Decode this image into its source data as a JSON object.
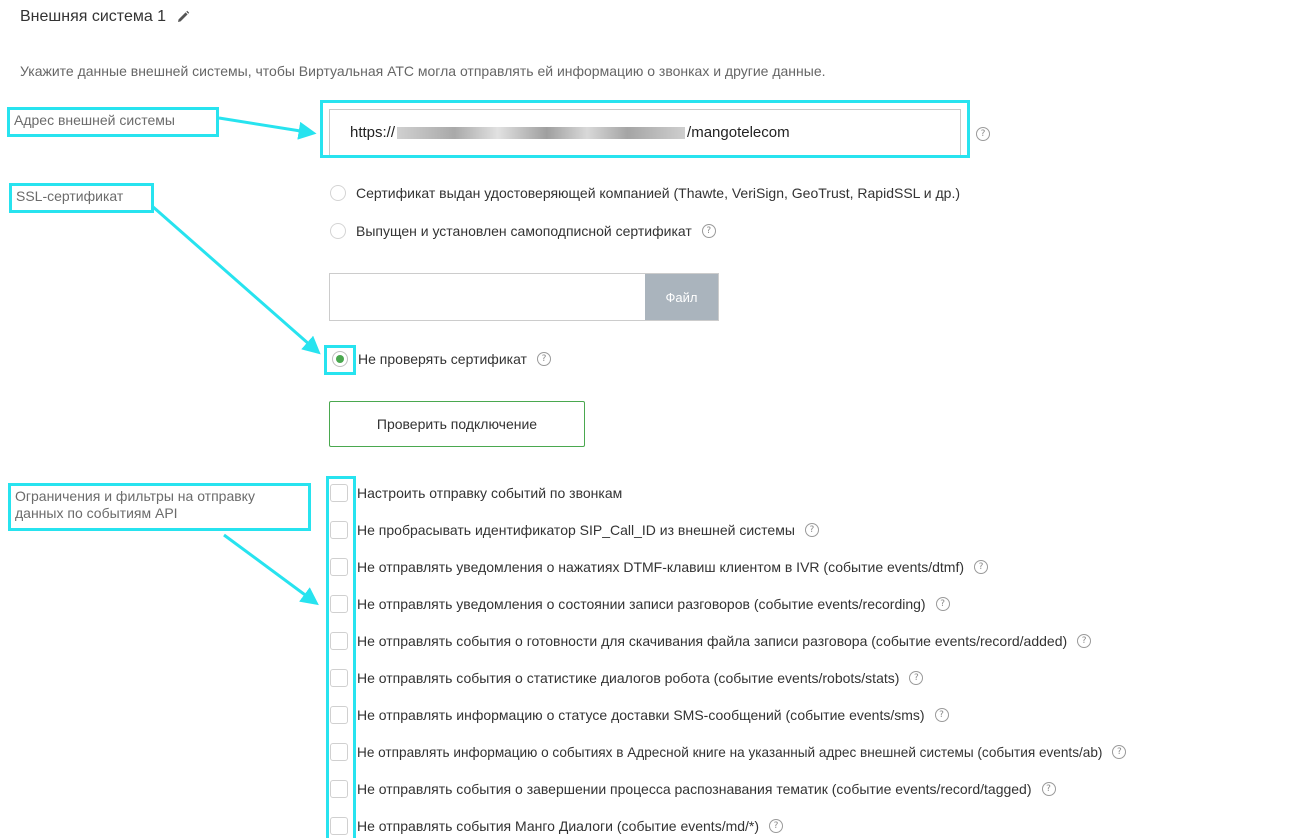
{
  "header": {
    "title": "Внешняя система 1",
    "edit_icon": "pencil-icon",
    "description": "Укажите данные внешней системы, чтобы Виртуальная АТС могла отправлять ей информацию о звонках и другие данные."
  },
  "annotations": {
    "address": "Адрес внешней системы",
    "ssl": "SSL-сертификат",
    "filters": "Ограничения и фильтры на отправку данных по событиям API"
  },
  "address": {
    "value_prefix": "https://",
    "value_suffix": "/mangotelecom",
    "help_icon": "help-icon"
  },
  "ssl": {
    "options": [
      {
        "label": "Сертификат выдан удостоверяющей компанией (Thawte, VeriSign, GeoTrust, RapidSSL и др.)",
        "selected": false,
        "help": false
      },
      {
        "label": "Выпущен и установлен самоподписной сертификат",
        "selected": false,
        "help": true
      }
    ],
    "file_button": "Файл",
    "file_value": "",
    "no_check_label": "Не проверять сертификат",
    "no_check_selected": true
  },
  "test_button": "Проверить подключение",
  "checkboxes": [
    {
      "label": "Настроить отправку событий по звонкам",
      "checked": false,
      "help": false
    },
    {
      "label": "Не пробрасывать идентификатор SIP_Call_ID из внешней системы",
      "checked": false,
      "help": true
    },
    {
      "label": "Не отправлять уведомления о нажатиях DTMF-клавиш клиентом в IVR (событие events/dtmf)",
      "checked": false,
      "help": true
    },
    {
      "label": "Не отправлять уведомления о состоянии записи разговоров (событие events/recording)",
      "checked": false,
      "help": true
    },
    {
      "label": "Не отправлять события о готовности для скачивания файла записи разговора (событие events/record/added)",
      "checked": false,
      "help": true
    },
    {
      "label": "Не отправлять события о статистике диалогов робота (событие events/robots/stats)",
      "checked": false,
      "help": true
    },
    {
      "label": "Не отправлять информацию о статусе доставки SMS-сообщений (событие events/sms)",
      "checked": false,
      "help": true
    },
    {
      "label": "Не отправлять информацию о событиях в Адресной книге на указанный адрес внешней системы (события events/ab)",
      "checked": false,
      "help": true
    },
    {
      "label": "Не отправлять события о завершении процесса распознавания тематик (событие events/record/tagged)",
      "checked": false,
      "help": true
    },
    {
      "label": "Не отправлять события Манго Диалоги (событие events/md/*)",
      "checked": false,
      "help": true
    }
  ],
  "colors": {
    "annotation": "#27e3ef",
    "accent_green": "#4aa84f",
    "file_button": "#aab4bd"
  }
}
